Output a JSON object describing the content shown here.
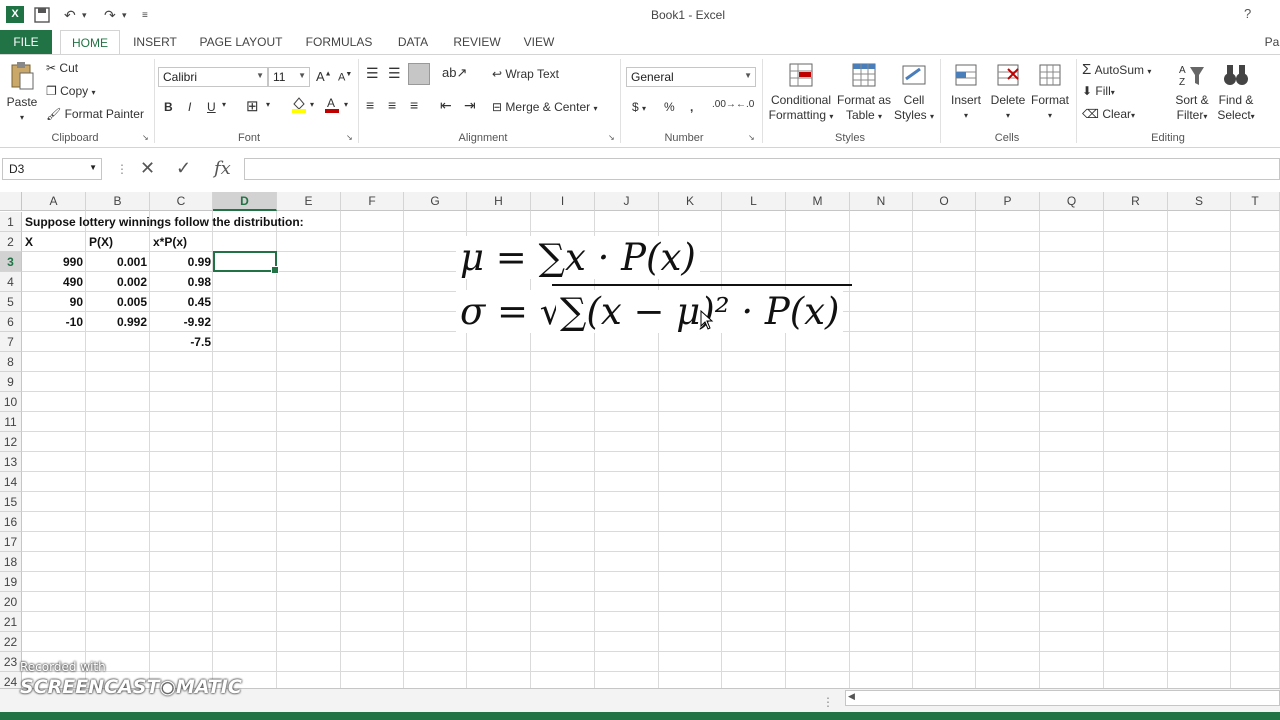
{
  "window": {
    "title": "Book1 - Excel",
    "user_initials": "Pa"
  },
  "quick_access": {
    "undo": "↶",
    "redo": "↷"
  },
  "tabs": [
    "FILE",
    "HOME",
    "INSERT",
    "PAGE LAYOUT",
    "FORMULAS",
    "DATA",
    "REVIEW",
    "VIEW"
  ],
  "ribbon": {
    "clipboard": {
      "paste": "Paste",
      "cut": "Cut",
      "copy": "Copy",
      "format_painter": "Format Painter",
      "label": "Clipboard"
    },
    "font": {
      "name": "Calibri",
      "size": "11",
      "bold": "B",
      "italic": "I",
      "underline": "U",
      "grow": "A",
      "shrink": "A",
      "label": "Font"
    },
    "alignment": {
      "wrap": "Wrap Text",
      "merge": "Merge & Center",
      "label": "Alignment"
    },
    "number": {
      "format": "General",
      "currency": "$",
      "percent": "%",
      "comma": ",",
      "label": "Number"
    },
    "styles": {
      "conditional": "Conditional",
      "conditional2": "Formatting",
      "format_as": "Format as",
      "format_as2": "Table",
      "cell": "Cell",
      "cell2": "Styles",
      "label": "Styles"
    },
    "cells": {
      "insert": "Insert",
      "delete": "Delete",
      "format": "Format",
      "label": "Cells"
    },
    "editing": {
      "autosum": "AutoSum",
      "fill": "Fill",
      "clear": "Clear",
      "sort": "Sort &",
      "sort2": "Filter",
      "find": "Find &",
      "find2": "Select",
      "label": "Editing"
    }
  },
  "formula_bar": {
    "name_box": "D3",
    "cancel": "✕",
    "enter": "✓",
    "fx": "fx",
    "value": ""
  },
  "columns": [
    "A",
    "B",
    "C",
    "D",
    "E",
    "F",
    "G",
    "H",
    "I",
    "J",
    "K",
    "L",
    "M",
    "N",
    "O",
    "P",
    "Q",
    "R",
    "S",
    "T"
  ],
  "rows": [
    "1",
    "2",
    "3",
    "4",
    "5",
    "6",
    "7",
    "8",
    "9",
    "10",
    "11",
    "12",
    "13",
    "14",
    "15",
    "16",
    "17",
    "18",
    "19",
    "20",
    "21",
    "22",
    "23",
    "24"
  ],
  "cells": {
    "a1": "Suppose lottery winnings follow the distribution:",
    "a2": "X",
    "b2": "P(X)",
    "c2": "x*P(x)",
    "a3": "990",
    "b3": "0.001",
    "c3": "0.99",
    "a4": "490",
    "b4": "0.002",
    "c4": "0.98",
    "a5": "90",
    "b5": "0.005",
    "c5": "0.45",
    "a6": "-10",
    "b6": "0.992",
    "c6": "-9.92",
    "c7": "-7.5"
  },
  "formulas": {
    "mu": "μ = ∑x · P(x)",
    "sigma_lhs": "σ = √",
    "sigma_rhs": "∑(x − μ)² · P(x)"
  },
  "watermark": {
    "line1": "Recorded with",
    "line2": "SCREENCAST◉MATIC"
  }
}
